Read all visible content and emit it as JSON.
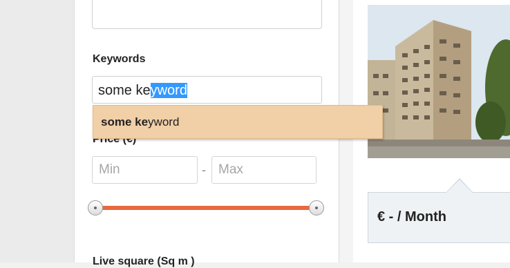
{
  "form": {
    "keywords_label": "Keywords",
    "keywords_value_plain": "some ke",
    "keywords_value_selected": "yword",
    "suggestion": {
      "bold": "some ke",
      "rest": "yword"
    },
    "price_label": "Price (€)",
    "min_placeholder": "Min",
    "max_placeholder": "Max",
    "range_separator": "-",
    "live_area_label": "Live square (Sq m )"
  },
  "listing": {
    "price_text": "€ - / Month"
  },
  "colors": {
    "slider_track": "#e66a3f",
    "suggestion_bg": "#f1cfa7",
    "selection_bg": "#3399ff"
  }
}
